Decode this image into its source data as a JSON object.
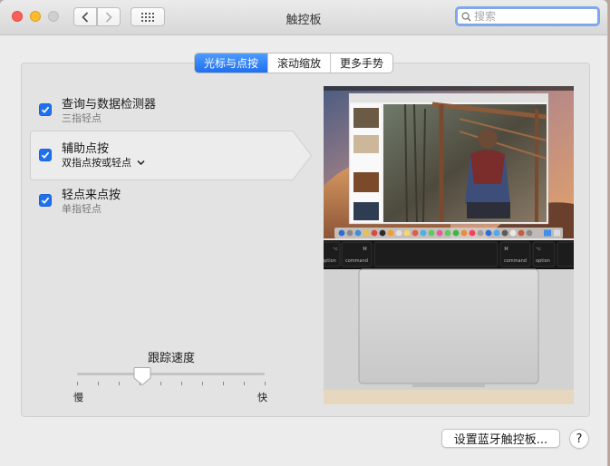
{
  "window": {
    "title": "触控板",
    "search_placeholder": "搜索"
  },
  "tabs": [
    {
      "label": "光标与点按",
      "active": true
    },
    {
      "label": "滚动缩放",
      "active": false
    },
    {
      "label": "更多手势",
      "active": false
    }
  ],
  "options": [
    {
      "title": "查询与数据检测器",
      "subtitle": "三指轻点",
      "checked": true
    },
    {
      "title": "辅助点按",
      "subtitle": "双指点按或轻点",
      "checked": true,
      "has_dropdown": true,
      "selected": true
    },
    {
      "title": "轻点来点按",
      "subtitle": "单指轻点",
      "checked": true
    }
  ],
  "tracking": {
    "label": "跟踪速度",
    "min_label": "慢",
    "max_label": "快",
    "value": 0.35,
    "tick_count": 10
  },
  "preview": {
    "keys": {
      "left_option": "option",
      "left_command": "command",
      "right_command": "command",
      "right_option": "option",
      "cmd_symbol": "⌘",
      "opt_symbol": "⌥"
    }
  },
  "footer": {
    "bluetooth_button": "设置蓝牙触控板...",
    "help_button": "?"
  },
  "colors": {
    "accent": "#1f70ee",
    "window_bg": "#ececec",
    "panel_bg": "#e3e3e3"
  }
}
